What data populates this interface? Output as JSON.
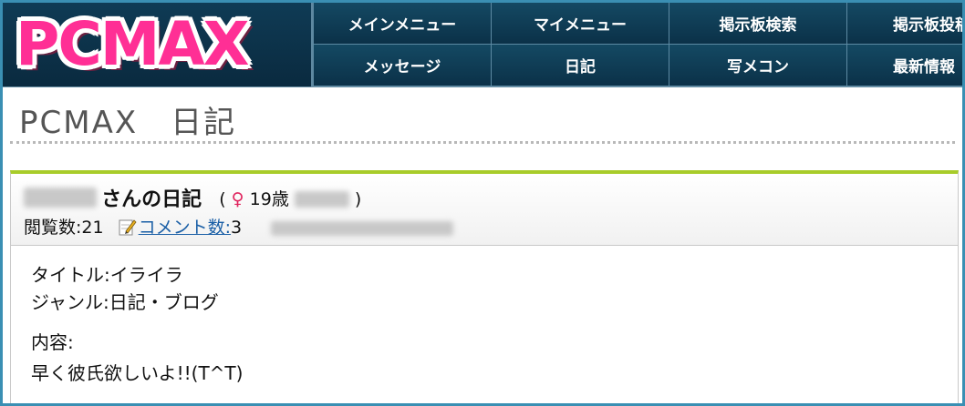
{
  "logo": {
    "text": "PCMAX"
  },
  "nav": {
    "row1": [
      "メインメニュー",
      "マイメニュー",
      "掲示板検索",
      "掲示板投稿"
    ],
    "row2": [
      "メッセージ",
      "日記",
      "写メコン",
      "最新情報"
    ]
  },
  "page": {
    "title": "PCMAX　日記"
  },
  "diary": {
    "owner_suffix": "さんの日記",
    "meta_open": "(",
    "gender_symbol": "♀",
    "age": "19歳",
    "meta_close": ")",
    "views_label": "閲覧数:",
    "views": "21",
    "comments_label": "コメント数:",
    "comments": "3"
  },
  "content": {
    "title_line": "タイトル:イライラ",
    "genre_line": "ジャンル:日記・ブログ",
    "body_label": "内容:",
    "body_text": "早く彼氏欲しいよ!!(T^T)"
  },
  "colors": {
    "header_bg": "#0c2f45",
    "logo_pink": "#ff2f95",
    "accent_green": "#a8cc2a",
    "frame_blue": "#3a8fb3",
    "link_blue": "#1a5fa6",
    "female_red": "#e0245e"
  }
}
